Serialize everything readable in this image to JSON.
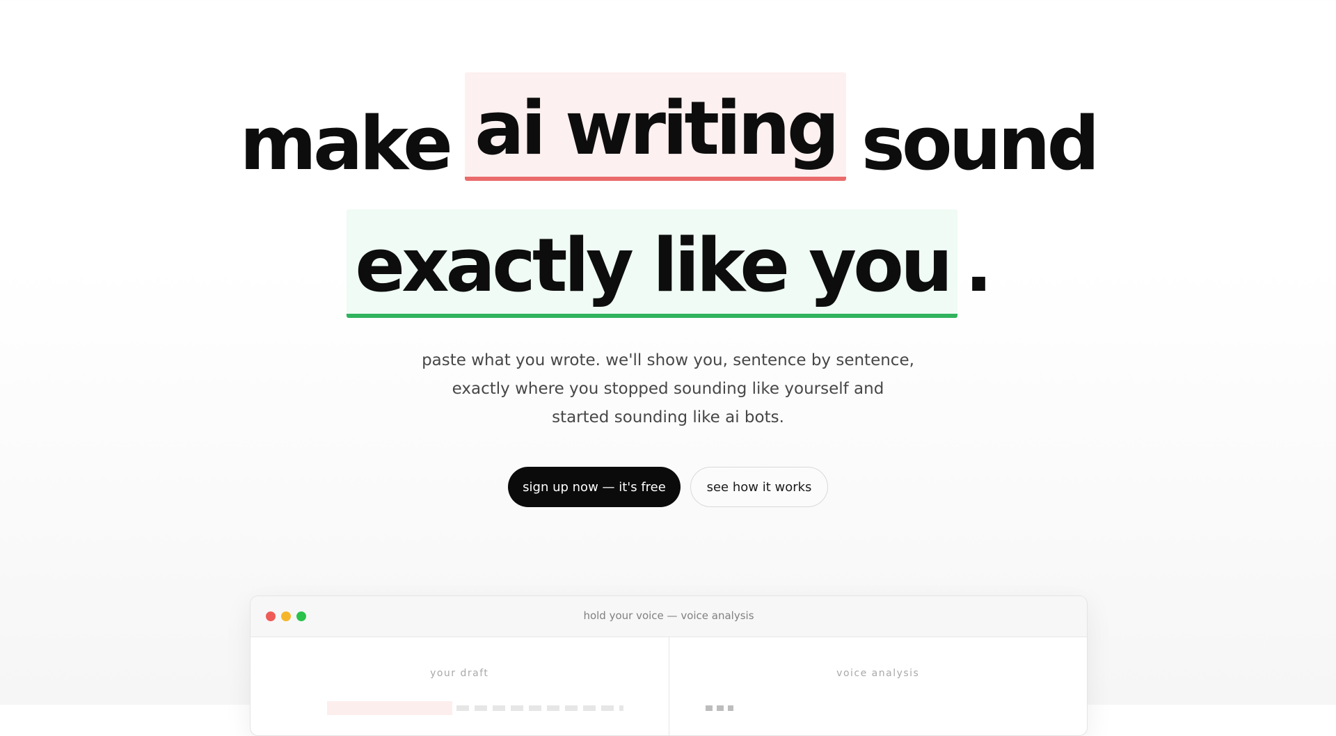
{
  "headline": {
    "line1": {
      "word1": "make",
      "highlight": "ai writing",
      "word2": "sound"
    },
    "line2": {
      "highlight": "exactly like you",
      "punct": "."
    }
  },
  "subtitle": {
    "line1": "paste what you wrote. we'll show you, sentence by sentence,",
    "line2": "exactly where you stopped sounding like yourself and",
    "line3": "started sounding like ai bots."
  },
  "cta": {
    "primary_label": "sign up now — it's free",
    "secondary_label": "see how it works"
  },
  "demo_window": {
    "title": "hold your voice — voice analysis",
    "left_pane_label": "your draft",
    "right_pane_label": "voice analysis"
  },
  "colors": {
    "highlight_red_bg": "#fdf0f0",
    "highlight_red_underline": "#ea6b6b",
    "highlight_green_bg": "#effbf4",
    "highlight_green_underline": "#2fb35d",
    "primary_button": "#0b0b0b",
    "traffic_red": "#ef5b56",
    "traffic_yellow": "#f5b62c",
    "traffic_green": "#2ac24a"
  }
}
